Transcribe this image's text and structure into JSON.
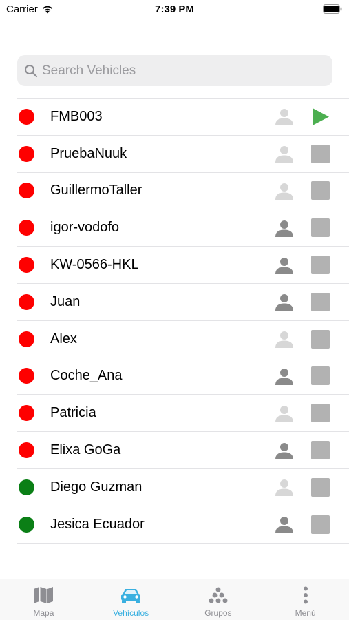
{
  "status_bar": {
    "carrier": "Carrier",
    "time": "7:39 PM"
  },
  "search": {
    "placeholder": "Search Vehicles",
    "value": ""
  },
  "vehicles": [
    {
      "name": "FMB003",
      "status": "red",
      "driver": "light",
      "action": "play"
    },
    {
      "name": "PruebaNuuk",
      "status": "red",
      "driver": "light",
      "action": "stop"
    },
    {
      "name": "GuillermoTaller",
      "status": "red",
      "driver": "light",
      "action": "stop"
    },
    {
      "name": "igor-vodofo",
      "status": "red",
      "driver": "dark",
      "action": "stop"
    },
    {
      "name": "KW-0566-HKL",
      "status": "red",
      "driver": "dark",
      "action": "stop"
    },
    {
      "name": "Juan",
      "status": "red",
      "driver": "dark",
      "action": "stop"
    },
    {
      "name": "Alex",
      "status": "red",
      "driver": "light",
      "action": "stop"
    },
    {
      "name": "Coche_Ana",
      "status": "red",
      "driver": "dark",
      "action": "stop"
    },
    {
      "name": "Patricia",
      "status": "red",
      "driver": "light",
      "action": "stop"
    },
    {
      "name": "Elixa GoGa",
      "status": "red",
      "driver": "dark",
      "action": "stop"
    },
    {
      "name": "Diego Guzman",
      "status": "green",
      "driver": "light",
      "action": "stop"
    },
    {
      "name": "Jesica Ecuador",
      "status": "green",
      "driver": "dark",
      "action": "stop"
    }
  ],
  "colors": {
    "status_red": "#fe0000",
    "status_green": "#0b7f16",
    "play_green": "#4caf50",
    "active_tab": "#3ab0e0",
    "inactive_tab": "#8e8e93"
  },
  "tabbar": {
    "tabs": [
      {
        "label": "Mapa",
        "icon": "map-icon",
        "active": false
      },
      {
        "label": "Vehículos",
        "icon": "car-icon",
        "active": true
      },
      {
        "label": "Grupos",
        "icon": "groups-icon",
        "active": false
      },
      {
        "label": "Menú",
        "icon": "more-icon",
        "active": false
      }
    ]
  }
}
